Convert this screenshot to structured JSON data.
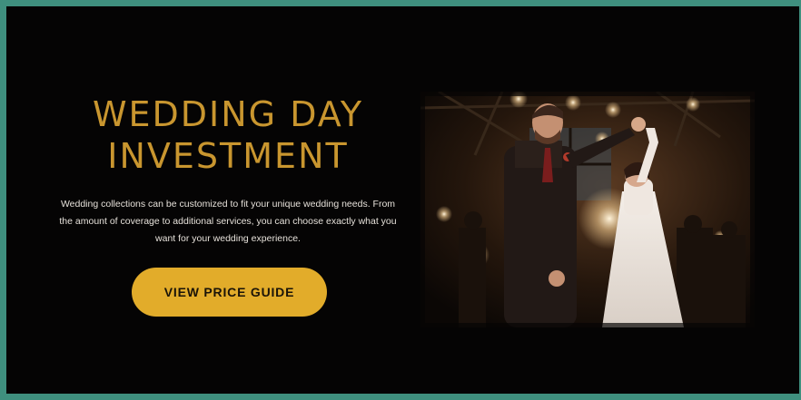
{
  "section": {
    "heading_line1": "WEDDING DAY",
    "heading_line2": "INVESTMENT",
    "description": "Wedding collections can be customized to fit your unique wedding needs. From the amount of coverage to additional services, you can choose exactly what you want for your wedding experience.",
    "cta_label": "VIEW PRICE GUIDE"
  },
  "photo": {
    "subject": "couple dancing at wedding reception"
  },
  "colors": {
    "border": "#3f8f7e",
    "background": "#050404",
    "heading": "#c9962f",
    "button": "#e2ac2a",
    "body_text": "#e6e1da"
  }
}
